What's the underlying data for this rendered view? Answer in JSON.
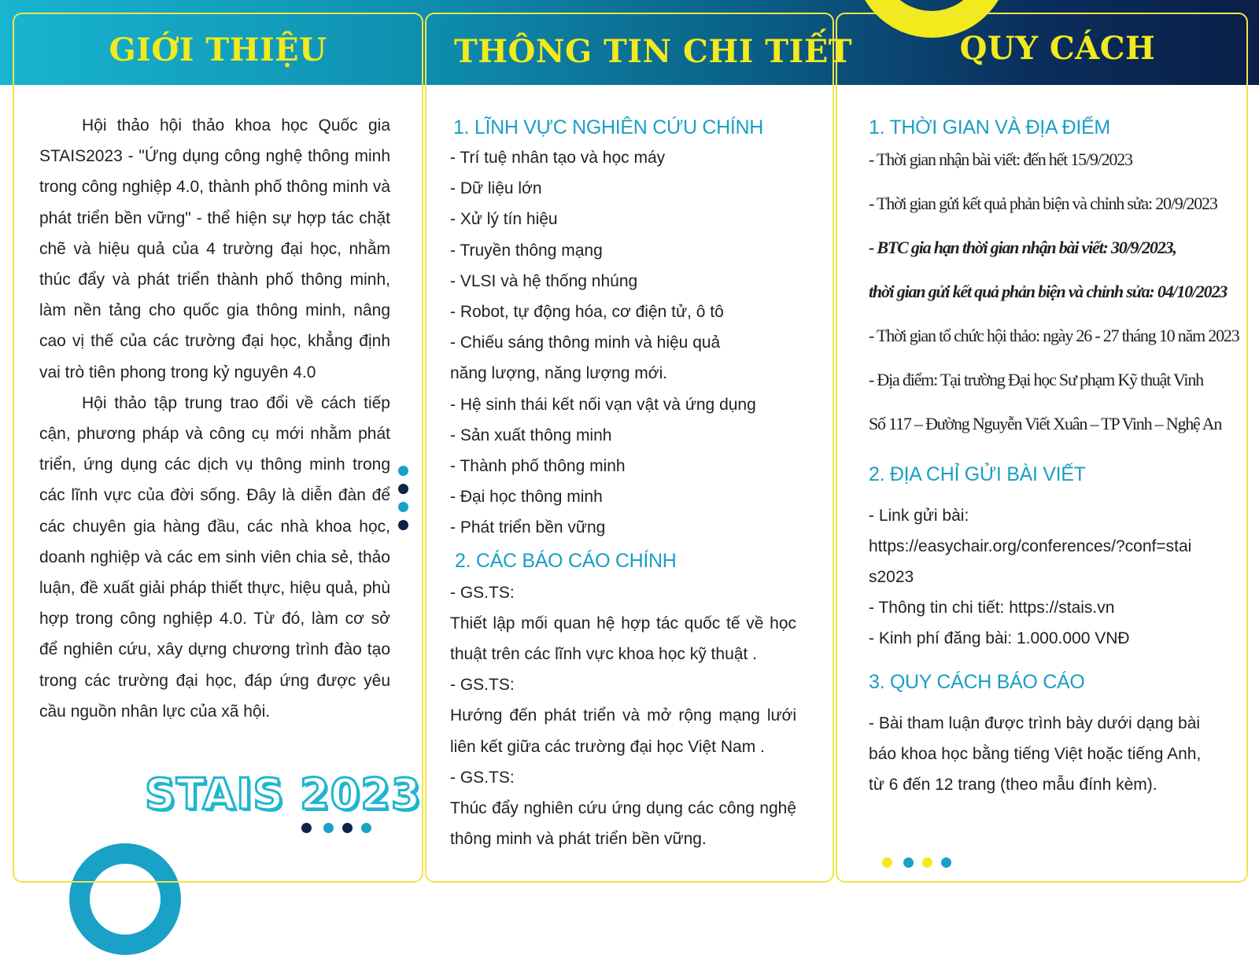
{
  "colors": {
    "accent_yellow": "#f2ea1c",
    "accent_cyan": "#1a9fc4",
    "navy": "#0b2e5c"
  },
  "intro": {
    "title": "GIỚI THIỆU",
    "paragraph1": "Hội thảo hội thảo khoa học Quốc gia STAIS2023 - \"Ứng dụng công nghệ thông minh trong công nghiệp 4.0, thành phố thông minh và phát triển bền vững\" - thể hiện sự hợp tác chặt chẽ và hiệu quả của 4 trường đại học, nhằm thúc đẩy và phát triển thành phố thông minh, làm nền tảng cho quốc gia thông minh, nâng cao vị thế của các trường đại học, khẳng định vai trò tiên phong trong kỷ nguyên 4.0",
    "paragraph2": "Hội thảo tập trung trao đổi về cách tiếp cận, phương pháp và công cụ mới nhằm phát triển, ứng dụng các dịch vụ thông minh trong các lĩnh vực của đời sống. Đây là diễn đàn để các chuyên gia hàng đầu, các nhà khoa học, doanh nghiệp và các em sinh viên chia sẻ, thảo luận, đề xuất giải pháp thiết thực, hiệu quả, phù hợp trong công nghiệp 4.0. Từ đó, làm cơ sở để nghiên cứu, xây dựng chương trình đào tạo trong các trường đại học, đáp ứng được yêu cầu nguồn nhân lực của xã hội.",
    "logo_text": "STAIS 2023"
  },
  "details": {
    "title": "THÔNG TIN CHI TIẾT",
    "section1_heading": "1. LĨNH VỰC NGHIÊN CỨU CHÍNH",
    "fields": [
      " - Trí tuệ nhân tạo và học máy",
      "- Dữ liệu lớn",
      "- Xử lý tín hiệu",
      "- Truyền thông mạng",
      "- VLSI và hệ thống nhúng",
      "- Robot, tự động hóa, cơ điện tử, ô tô",
      "- Chiếu sáng thông minh và hiệu quả",
      " năng lượng, năng lượng mới.",
      "- Hệ sinh thái kết nối vạn vật và ứng dụng",
      "- Sản xuất thông minh",
      "- Thành phố thông minh",
      "- Đại học thông minh",
      "- Phát triển bền vững"
    ],
    "section2_heading": "2. CÁC BÁO CÁO CHÍNH",
    "reports": [
      {
        "speaker": "- GS.TS:",
        "topic": "Thiết lập mối quan hệ hợp tác quốc tế về học thuật trên các lĩnh vực khoa học kỹ thuật ."
      },
      {
        "speaker": "- GS.TS:",
        "topic": "Hướng đến phát triển và mở rộng mạng lưới liên kết giữa các trường đại học Việt Nam ."
      },
      {
        "speaker": "- GS.TS:",
        "topic": "Thúc đẩy nghiên cứu ứng dụng các công nghệ thông minh và phát triển bền vững."
      }
    ]
  },
  "specs": {
    "title": "QUY CÁCH",
    "section1_heading": "1. THỜI GIAN VÀ ĐỊA ĐIỂM",
    "schedule": [
      "- Thời gian nhận bài viết: đến hết 15/9/2023",
      "- Thời gian gửi kết quả phản biện và chỉnh sửa: 20/9/2023"
    ],
    "extension_line1": "- BTC gia hạn thời gian nhận bài viết: 30/9/2023,",
    "extension_line2": "thời gian gửi kết quả phản biện và chỉnh sửa: 04/10/2023",
    "event_time": "- Thời gian tổ chức hội thảo: ngày 26 - 27 tháng 10 năm 2023",
    "venue_line1": "- Địa điểm: Tại trường Đại học Sư phạm Kỹ thuật Vinh",
    "venue_line2": "Số 117 – Đường Nguyễn Viết Xuân – TP Vinh – Nghệ An",
    "section2_heading": "2. ĐỊA CHỈ GỬI BÀI VIẾT",
    "submit_label": "-  Link gửi bài:",
    "submit_link_line1": "https://easychair.org/conferences/?conf=stai",
    "submit_link_line2": "s2023",
    "info_line": "-  Thông tin chi tiết: https://stais.vn",
    "fee_line": "-  Kinh phí đăng bài: 1.000.000 VNĐ",
    "section3_heading": "3. QUY CÁCH BÁO CÁO",
    "format_text": "-  Bài tham luận được trình bày dưới dạng bài báo khoa học bằng tiếng Việt hoặc tiếng Anh, từ 6 đến 12 trang (theo mẫu đính kèm)."
  }
}
